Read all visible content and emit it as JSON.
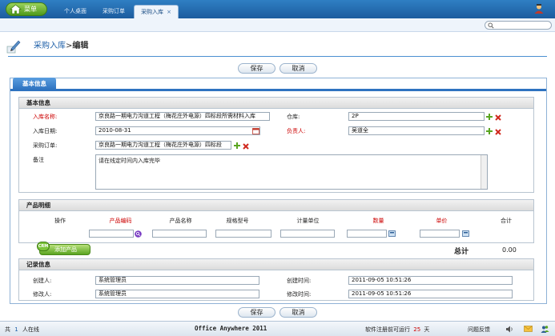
{
  "topbar": {
    "menu_label": "菜单",
    "tabs": [
      {
        "label": "个人桌面"
      },
      {
        "label": "采购订单"
      },
      {
        "label": "采购入库",
        "close": "×"
      }
    ]
  },
  "page": {
    "title": "采购入库",
    "separator": ">",
    "subtitle": "编辑"
  },
  "actions": {
    "save": "保存",
    "cancel": "取消"
  },
  "panel_tab": "基本信息",
  "basic": {
    "heading": "基本信息",
    "name_label": "入库名称:",
    "name_value": "京良路一期电力沟道工程（梅花庄外电源）四标段所需材料入库",
    "warehouse_label": "仓库:",
    "warehouse_value": "2P",
    "date_label": "入库日期:",
    "date_value": "2010-08-31",
    "owner_label": "负责人:",
    "owner_value": "吴道全",
    "order_label": "采购订单:",
    "order_value": "京良路一期电力沟道工程（梅花庄外电源）四标段",
    "remark_label": "备注",
    "remark_value": "请在线定时间内入库完毕"
  },
  "products": {
    "heading": "产品明细",
    "columns": [
      "操作",
      "产品编码",
      "产品名称",
      "规格型号",
      "计量单位",
      "数量",
      "单价",
      "合计"
    ],
    "add_button": "添加产品",
    "badge": "CRM",
    "total_label": "总计",
    "total_value": "0.00"
  },
  "record": {
    "heading": "记录信息",
    "creator_label": "创建人:",
    "creator_value": "系统管理员",
    "created_label": "创建时间:",
    "created_value": "2011-09-05 10:51:26",
    "modifier_label": "修改人:",
    "modifier_value": "系统管理员",
    "modified_label": "修改时间:",
    "modified_value": "2011-09-05 10:51:26"
  },
  "footer": {
    "online_prefix": "共",
    "online_count": "1",
    "online_suffix": "人在线",
    "product": "Office Anywhere 2011",
    "license_prefix": "软件注册前可运行",
    "license_days": "25",
    "license_suffix": "天",
    "feedback": "问题反馈"
  },
  "colors": {
    "brand_blue": "#1c5c9e",
    "required_red": "#cc0000",
    "accent_green": "#5aa521"
  }
}
